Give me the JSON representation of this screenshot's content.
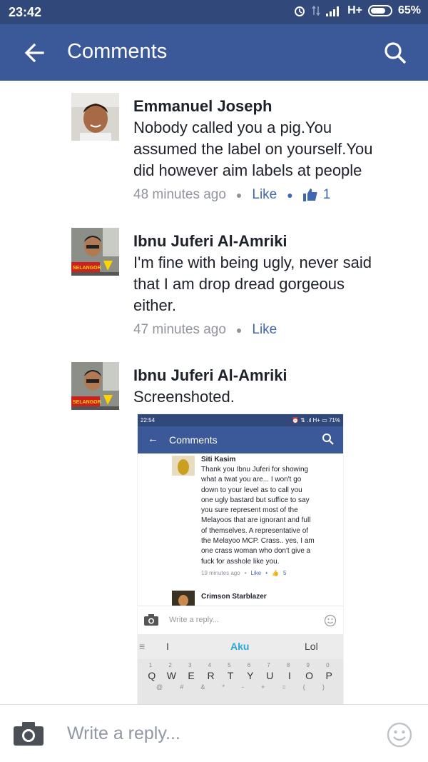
{
  "status_bar": {
    "time": "23:42",
    "network": "H+",
    "battery": "65%"
  },
  "app_bar": {
    "title": "Comments"
  },
  "comments": [
    {
      "author": "Emmanuel Joseph",
      "text_lines": [
        "Nobody called you a pig.You",
        "assumed the label on yourself.You",
        "did however aim labels at people"
      ],
      "time": "48 minutes ago",
      "like_label": "Like",
      "like_count": "1"
    },
    {
      "author": "Ibnu Juferi Al-Amriki",
      "text_lines": [
        "I'm fine with being ugly,  never said",
        "that I am drop dread gorgeous",
        "either."
      ],
      "time": "47 minutes ago",
      "like_label": "Like"
    },
    {
      "author": "Ibnu Juferi Al-Amriki",
      "text_lines": [
        "Screenshoted."
      ],
      "avatar_badge": "SELANGOR"
    }
  ],
  "embedded_screenshot": {
    "status": {
      "time": "22:54",
      "battery": "71%",
      "network": "H+"
    },
    "title": "Comments",
    "comment1": {
      "author": "Siti Kasim",
      "text_lines": [
        "Thank you Ibnu Juferi for showing",
        "what a twat you are...  I won't go",
        "down to your level as to call you",
        "one ugly bastard but suffice to say",
        "you sure represent most of the",
        "Melayoos that are ignorant and full",
        "of themselves.  A representative of",
        "the Melayoo MCP.  Crass.. yes, I am",
        "one crass woman who don't give a",
        "fuck for asshole like you."
      ],
      "time": "19 minutes ago",
      "like_label": "Like",
      "like_count": "5"
    },
    "comment2": {
      "author": "Crimson Starblazer"
    },
    "reply_placeholder": "Write a reply...",
    "keyboard": {
      "suggestions": [
        "I",
        "Aku",
        "Lol"
      ],
      "keys": [
        "Q",
        "W",
        "E",
        "R",
        "T",
        "Y",
        "U",
        "I",
        "O",
        "P"
      ],
      "numbers": [
        "1",
        "2",
        "3",
        "4",
        "5",
        "6",
        "7",
        "8",
        "9",
        "0"
      ],
      "symbols": [
        "@",
        "#",
        "&",
        "*",
        "-",
        "+",
        "=",
        "(",
        ")"
      ]
    }
  },
  "reply_bar": {
    "placeholder": "Write a reply..."
  },
  "colors": {
    "status_bar": "#31487a",
    "app_bar": "#3b5998",
    "link": "#4267b2",
    "meta": "#90949c"
  }
}
